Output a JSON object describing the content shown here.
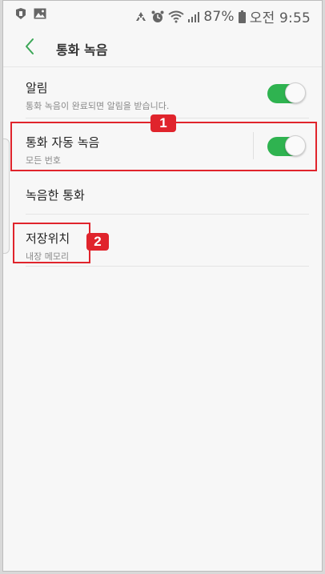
{
  "status_bar": {
    "battery_percent": "87%",
    "time": "오전 9:55",
    "icons": [
      "app-icon",
      "gallery-icon",
      "recycle-icon",
      "alarm-icon",
      "wifi-icon",
      "signal-icon",
      "battery-icon"
    ]
  },
  "header": {
    "title": "통화 녹음",
    "back_icon": "chevron-left-icon"
  },
  "settings": {
    "notification": {
      "title": "알림",
      "subtitle": "통화 녹음이 완료되면 알림을 받습니다.",
      "enabled": true
    },
    "auto_record": {
      "title": "통화 자동 녹음",
      "subtitle": "모든 번호",
      "enabled": true
    },
    "recorded_calls": {
      "title": "녹음한 통화"
    },
    "storage": {
      "title": "저장위치",
      "subtitle": "내장 메모리"
    }
  },
  "annotations": {
    "badge1": "1",
    "badge2": "2"
  },
  "colors": {
    "toggle_on": "#2fb350",
    "accent_back": "#3aa655",
    "annotation": "#e0242c"
  }
}
